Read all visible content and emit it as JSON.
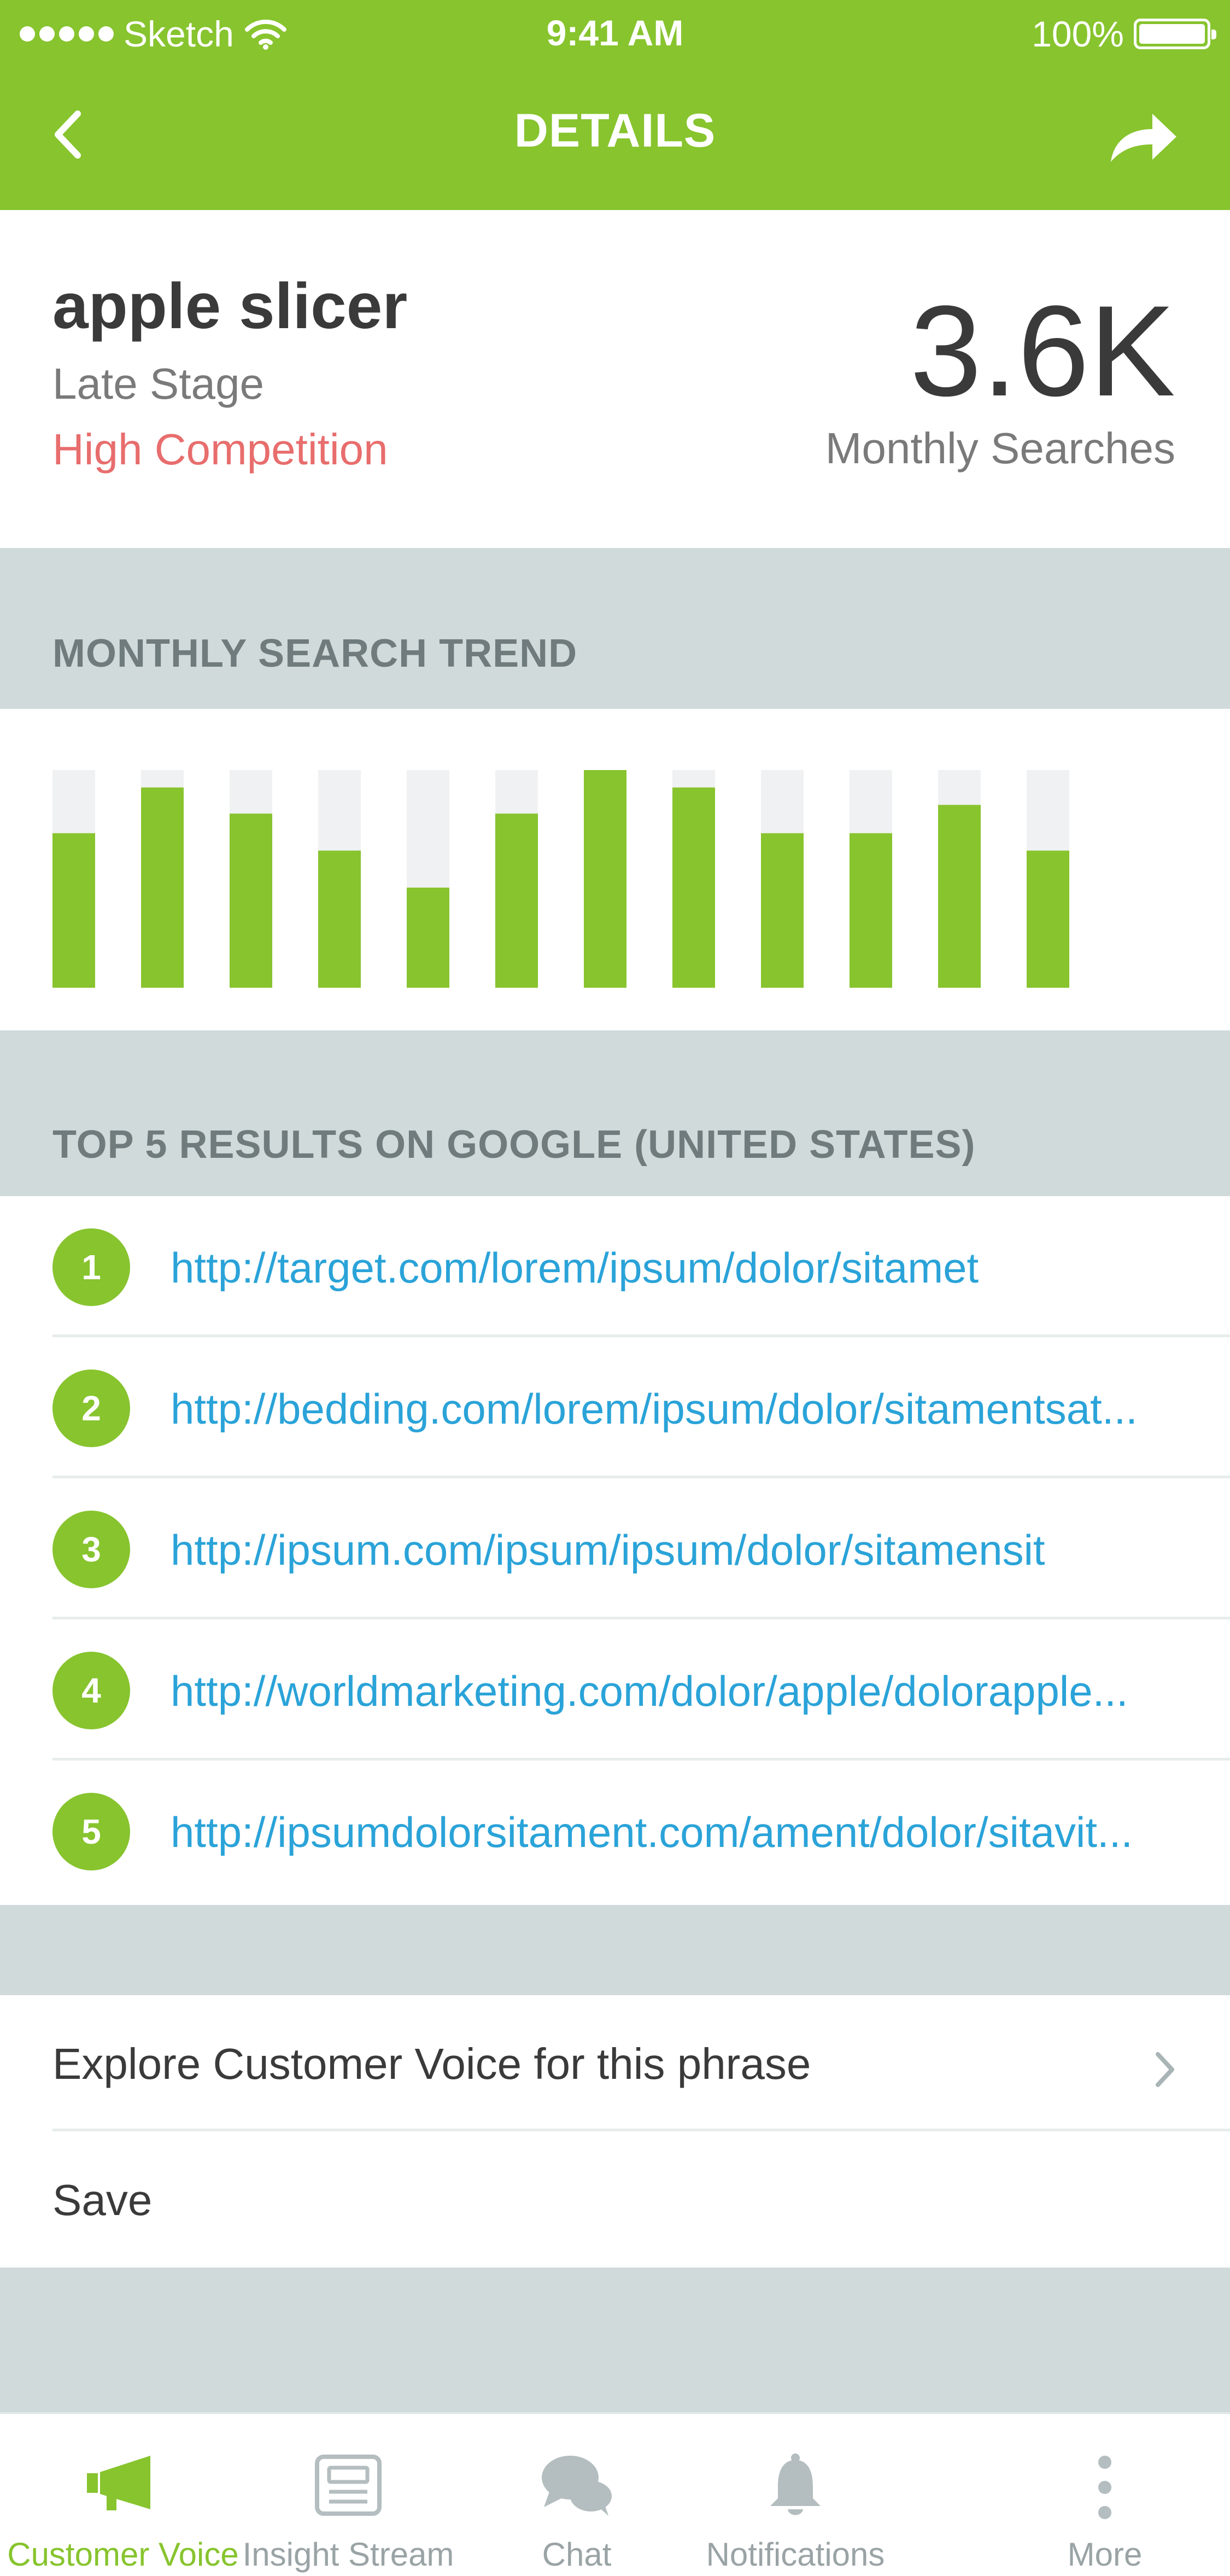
{
  "status_bar": {
    "carrier": "Sketch",
    "time": "9:41 AM",
    "battery": "100%"
  },
  "nav": {
    "title": "DETAILS"
  },
  "summary": {
    "keyword": "apple slicer",
    "stage": "Late Stage",
    "competition": "High Competition",
    "monthly_searches_value": "3.6K",
    "monthly_searches_label": "Monthly Searches"
  },
  "trend_section": {
    "title": "MONTHLY SEARCH TREND"
  },
  "chart_data": {
    "type": "bar",
    "categories": [
      "",
      "",
      "",
      "",
      "",
      "",
      "",
      "",
      "",
      "",
      "",
      ""
    ],
    "values": [
      71,
      92,
      80,
      63,
      46,
      80,
      100,
      92,
      71,
      71,
      84,
      63
    ],
    "ylim": [
      0,
      100
    ],
    "bar_color": "#87c42e",
    "track_color": "#f0f1f2",
    "grid": false
  },
  "results_section": {
    "title": "TOP 5 RESULTS ON GOOGLE (UNITED STATES)",
    "items": [
      {
        "rank": "1",
        "url": "http://target.com/lorem/ipsum/dolor/sitamet"
      },
      {
        "rank": "2",
        "url": "http://bedding.com/lorem/ipsum/dolor/sitamentsat..."
      },
      {
        "rank": "3",
        "url": "http://ipsum.com/ipsum/ipsum/dolor/sitamensit"
      },
      {
        "rank": "4",
        "url": "http://worldmarketing.com/dolor/apple/dolorapple..."
      },
      {
        "rank": "5",
        "url": "http://ipsumdolorsitament.com/ament/dolor/sitavit..."
      }
    ]
  },
  "actions": {
    "explore_label": "Explore Customer Voice for this phrase",
    "save_label": "Save"
  },
  "tabbar": {
    "items": [
      {
        "label": "Customer Voice",
        "icon": "megaphone-icon",
        "active": true
      },
      {
        "label": "Insight Stream",
        "icon": "newspaper-icon",
        "active": false
      },
      {
        "label": "Chat",
        "icon": "chat-bubbles-icon",
        "active": false
      },
      {
        "label": "Notifications",
        "icon": "bell-icon",
        "active": false
      },
      {
        "label": "More",
        "icon": "more-vertical-icon",
        "active": false
      }
    ]
  },
  "colors": {
    "accent": "#87c42e",
    "link": "#2aa3d8",
    "danger": "#e86d6d",
    "section_bg": "#d0dadb"
  }
}
